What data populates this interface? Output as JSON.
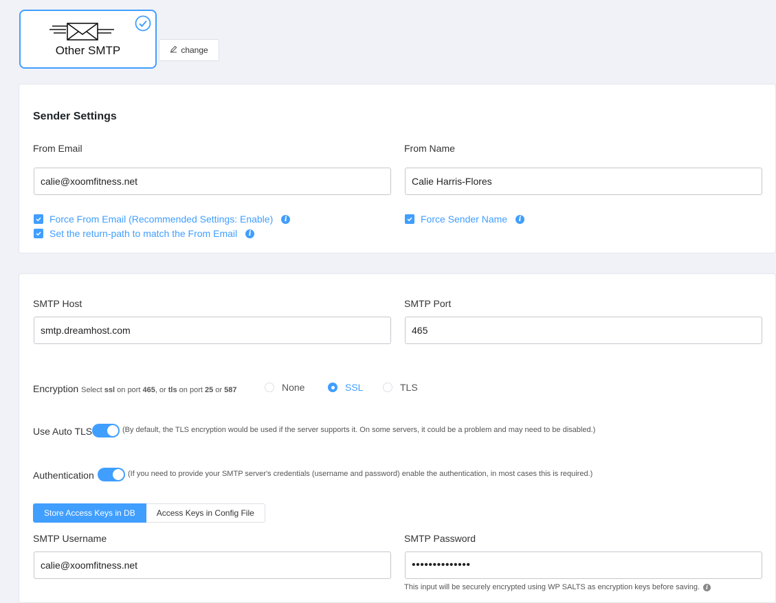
{
  "provider": {
    "label": "Other SMTP",
    "change_label": "change"
  },
  "sender": {
    "heading": "Sender Settings",
    "from_email_label": "From Email",
    "from_email_value": "calie@xoomfitness.net",
    "from_name_label": "From Name",
    "from_name_value": "Calie Harris-Flores",
    "force_from_email_label": "Force From Email (Recommended Settings: Enable)",
    "return_path_label": "Set the return-path to match the From Email",
    "force_sender_name_label": "Force Sender Name"
  },
  "smtp": {
    "host_label": "SMTP Host",
    "host_value": "smtp.dreamhost.com",
    "port_label": "SMTP Port",
    "port_value": "465",
    "encryption_label": "Encryption",
    "encryption_hint": {
      "p1": "Select ",
      "ssl": "ssl",
      "p2": " on port ",
      "port465": "465",
      "p3": ", or ",
      "tls": "tls",
      "p4": " on port ",
      "port25": "25",
      "p5": " or ",
      "port587": "587"
    },
    "encryption_options": [
      "None",
      "SSL",
      "TLS"
    ],
    "encryption_selected": "SSL",
    "auto_tls_label": "Use Auto TLS",
    "auto_tls_hint": "(By default, the TLS encryption would be used if the server supports it. On some servers, it could be a problem and may need to be disabled.)",
    "auto_tls_on": true,
    "auth_label": "Authentication",
    "auth_hint": "(If you need to provide your SMTP server's credentials (username and password) enable the authentication, in most cases this is required.)",
    "auth_on": true,
    "tabs": [
      "Store Access Keys in DB",
      "Access Keys in Config File"
    ],
    "username_label": "SMTP Username",
    "username_value": "calie@xoomfitness.net",
    "password_label": "SMTP Password",
    "password_value": "••••••••••••••",
    "password_note": "This input will be securely encrypted using WP SALTS as encryption keys before saving."
  },
  "colors": {
    "accent": "#409eff"
  }
}
